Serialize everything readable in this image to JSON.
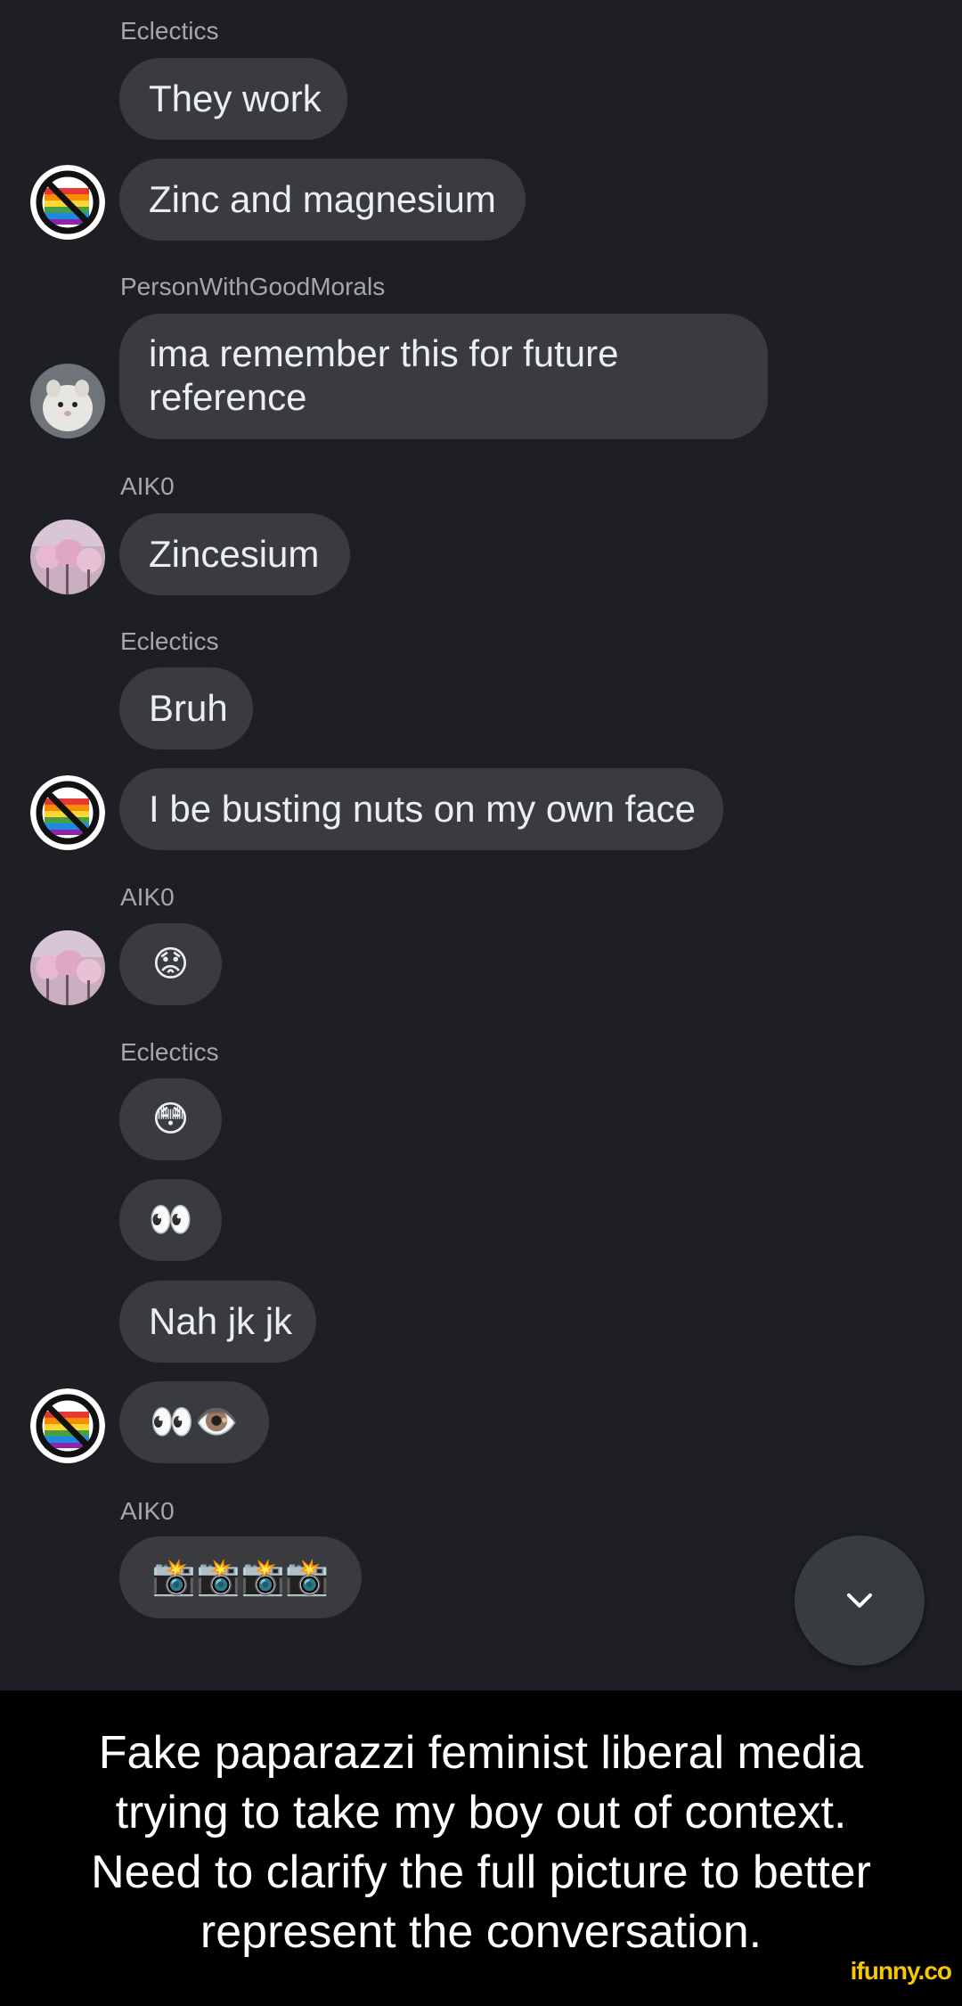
{
  "messages": [
    {
      "sender": "Eclectics",
      "text": "They work"
    },
    {
      "text": "Zinc and magnesium"
    },
    {
      "sender": "PersonWithGoodMorals",
      "text": "ima remember this for future reference"
    },
    {
      "sender": "AIK0",
      "text": "Zincesium"
    },
    {
      "sender": "Eclectics",
      "text": "Bruh"
    },
    {
      "text": "I be busting nuts on my own face"
    },
    {
      "sender": "AIK0",
      "text": "😟"
    },
    {
      "sender": "Eclectics",
      "text": "😳"
    },
    {
      "text": "👀"
    },
    {
      "text": "Nah jk jk"
    },
    {
      "text": "👀👁️"
    },
    {
      "sender": "AIK0",
      "text": "📸📸📸📸"
    }
  ],
  "scroll_button": {
    "icon": "chevron-down-icon"
  },
  "caption": {
    "lines": [
      "Fake paparazzi feminist liberal media",
      "trying to take my boy out of context.",
      "Need to clarify the full picture to better",
      "represent the conversation."
    ]
  },
  "watermark": "ifunny.co",
  "colors": {
    "background": "#1e1f24",
    "bubble": "#3a3b3f",
    "sender": "#a4a7ad",
    "caption_background": "#000000",
    "watermark": "#f6c800"
  }
}
